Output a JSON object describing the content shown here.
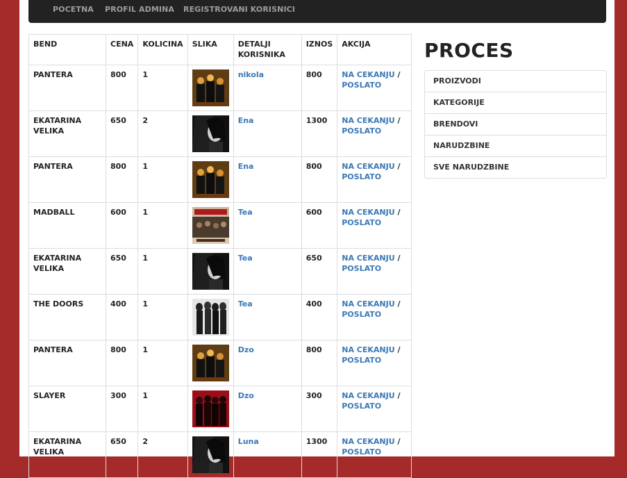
{
  "nav": {
    "items": [
      "POCETNA",
      "PROFIL ADMINA",
      "REGISTROVANI KORISNICI"
    ]
  },
  "table": {
    "headers": {
      "bend": "BEND",
      "cena": "CENA",
      "kolicina": "KOLICINA",
      "slika": "SLIKA",
      "detalji": "DETALJI KORISNIKA",
      "iznos": "IZNOS",
      "akcija": "AKCIJA"
    },
    "rows": [
      {
        "bend": "PANTERA",
        "cena": "800",
        "kolicina": "1",
        "image": "pantera-thumbnail",
        "korisnik": "nikola",
        "iznos": "800"
      },
      {
        "bend": "EKATARINA VELIKA",
        "cena": "650",
        "kolicina": "2",
        "image": "ekatarina-velika-thumbnail",
        "korisnik": "Ena",
        "iznos": "1300"
      },
      {
        "bend": "PANTERA",
        "cena": "800",
        "kolicina": "1",
        "image": "pantera-thumbnail",
        "korisnik": "Ena",
        "iznos": "800"
      },
      {
        "bend": "MADBALL",
        "cena": "600",
        "kolicina": "1",
        "image": "madball-thumbnail",
        "korisnik": "Tea",
        "iznos": "600"
      },
      {
        "bend": "EKATARINA VELIKA",
        "cena": "650",
        "kolicina": "1",
        "image": "ekatarina-velika-thumbnail",
        "korisnik": "Tea",
        "iznos": "650"
      },
      {
        "bend": "THE DOORS",
        "cena": "400",
        "kolicina": "1",
        "image": "the-doors-thumbnail",
        "korisnik": "Tea",
        "iznos": "400"
      },
      {
        "bend": "PANTERA",
        "cena": "800",
        "kolicina": "1",
        "image": "pantera-thumbnail",
        "korisnik": "Dzo",
        "iznos": "800"
      },
      {
        "bend": "SLAYER",
        "cena": "300",
        "kolicina": "1",
        "image": "slayer-thumbnail",
        "korisnik": "Dzo",
        "iznos": "300"
      },
      {
        "bend": "EKATARINA VELIKA",
        "cena": "650",
        "kolicina": "2",
        "image": "ekatarina-velika-thumbnail",
        "korisnik": "Luna",
        "iznos": "1300"
      }
    ],
    "action_pending": "NA CEKANJU",
    "action_separator": "/",
    "action_sent": "POSLATO"
  },
  "sidebar": {
    "title": "PROCES",
    "items": [
      "PROIZVODI",
      "KATEGORIJE",
      "BRENDOVI",
      "NARUDZBINE",
      "SVE NARUDZBINE"
    ]
  },
  "colors": {
    "page_background": "#a52a2a",
    "navbar": "#222222",
    "link": "#3a78b5"
  }
}
